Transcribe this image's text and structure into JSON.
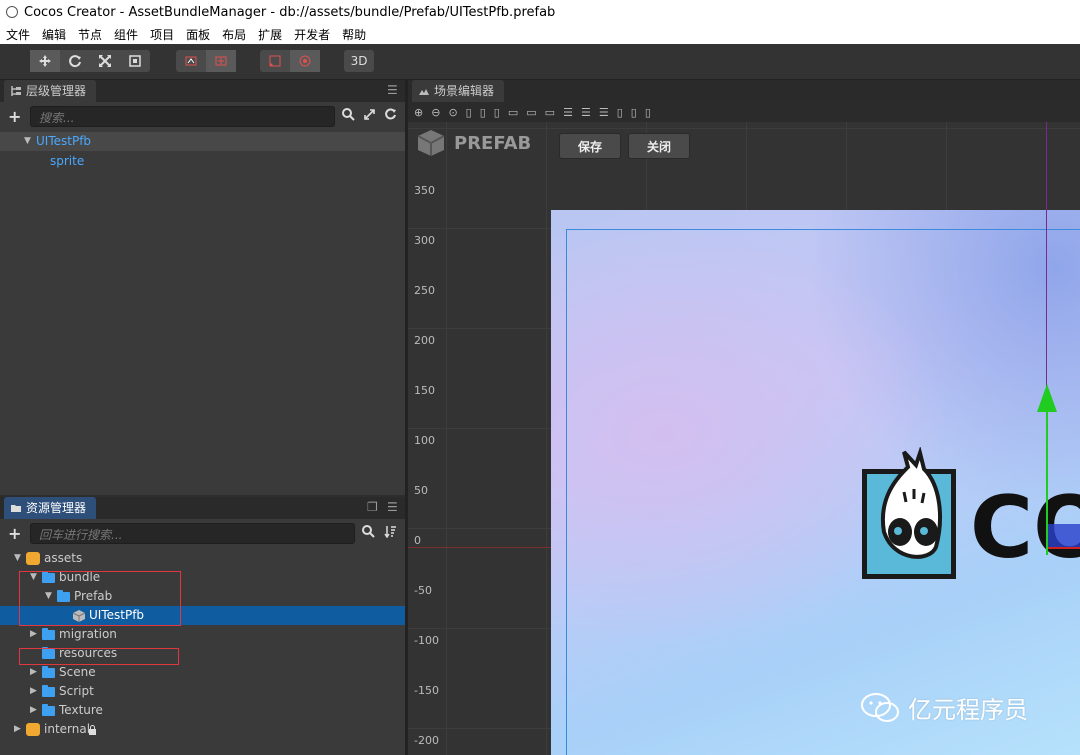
{
  "window": {
    "title": "Cocos Creator - AssetBundleManager - db://assets/bundle/Prefab/UITestPfb.prefab"
  },
  "menu": [
    "文件",
    "编辑",
    "节点",
    "组件",
    "项目",
    "面板",
    "布局",
    "扩展",
    "开发者",
    "帮助"
  ],
  "toolbar": {
    "mode_3d": "3D"
  },
  "hierarchy": {
    "tab": "层级管理器",
    "search_placeholder": "搜索...",
    "nodes": [
      {
        "label": "UITestPfb"
      },
      {
        "label": "sprite"
      }
    ]
  },
  "assets": {
    "tab": "资源管理器",
    "search_placeholder": "回车进行搜索...",
    "items": [
      {
        "label": "assets"
      },
      {
        "label": "bundle"
      },
      {
        "label": "Prefab"
      },
      {
        "label": "UITestPfb"
      },
      {
        "label": "migration"
      },
      {
        "label": "resources"
      },
      {
        "label": "Scene"
      },
      {
        "label": "Script"
      },
      {
        "label": "Texture"
      },
      {
        "label": "internal"
      }
    ]
  },
  "scene": {
    "tab": "场景编辑器",
    "prefab_label": "PREFAB",
    "save_label": "保存",
    "close_label": "关闭",
    "y_ticks": [
      "350",
      "300",
      "250",
      "200",
      "150",
      "100",
      "50",
      "0",
      "-50",
      "-100",
      "-150",
      "-200"
    ],
    "logo_text": "COC"
  },
  "watermark": {
    "text": "亿元程序员"
  },
  "colors": {
    "selection": "#0f5ca0",
    "node_text": "#4aa8ff",
    "red_box": "#e0383e",
    "y_axis_gizmo": "#1fcc1f"
  }
}
